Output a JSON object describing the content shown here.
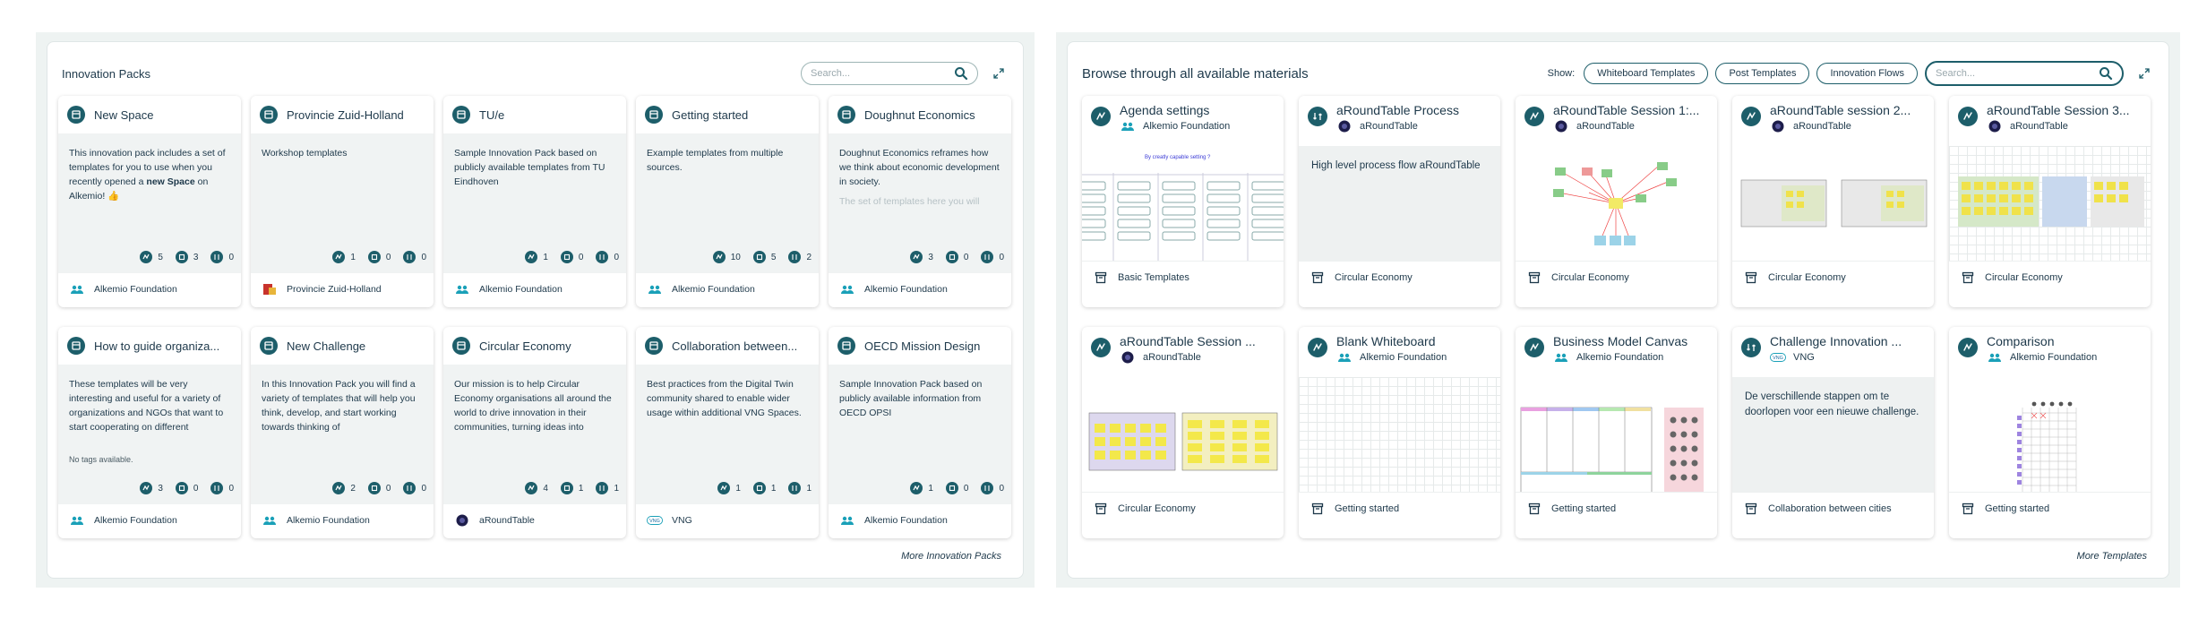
{
  "innovation_packs": {
    "title": "Innovation Packs",
    "search_placeholder": "Search...",
    "more_link": "More Innovation Packs",
    "cards": [
      {
        "title": "New Space",
        "desc_html": true,
        "desc_pre": "This innovation pack includes a set of templates for you to use when you recently opened a ",
        "desc_bold": "new Space",
        "desc_post": " on Alkemio! 👍",
        "tags": "",
        "c1": "5",
        "c2": "3",
        "c3": "0",
        "host": "Alkemio Foundation",
        "host_icon": "people-icon"
      },
      {
        "title": "Provincie Zuid-Holland",
        "desc": "Workshop templates",
        "tags": "",
        "c1": "1",
        "c2": "0",
        "c3": "0",
        "host": "Provincie Zuid-Holland",
        "host_icon": "province-logo-icon"
      },
      {
        "title": "TU/e",
        "desc": "Sample Innovation Pack based on publicly available templates from TU Eindhoven",
        "tags": "",
        "c1": "1",
        "c2": "0",
        "c3": "0",
        "host": "Alkemio Foundation",
        "host_icon": "people-icon"
      },
      {
        "title": "Getting started",
        "desc": "Example templates from multiple sources.",
        "tags": "",
        "c1": "10",
        "c2": "5",
        "c3": "2",
        "host": "Alkemio Foundation",
        "host_icon": "people-icon"
      },
      {
        "title": "Doughnut Economics",
        "desc": "Doughnut Economics reframes how we think about economic development in society.",
        "desc_fade": "The set of templates here you will",
        "tags": "",
        "c1": "3",
        "c2": "0",
        "c3": "0",
        "host": "Alkemio Foundation",
        "host_icon": "people-icon"
      },
      {
        "title": "How to guide organiza...",
        "desc": "These templates will be very interesting and useful for a variety of organizations and NGOs that want to start cooperating on different",
        "tags": "No tags available.",
        "c1": "3",
        "c2": "0",
        "c3": "0",
        "host": "Alkemio Foundation",
        "host_icon": "people-icon"
      },
      {
        "title": "New Challenge",
        "desc": "In this Innovation Pack you will find a variety of templates that will help you think, develop, and start working towards thinking of",
        "tags": "",
        "c1": "2",
        "c2": "0",
        "c3": "0",
        "host": "Alkemio Foundation",
        "host_icon": "people-icon"
      },
      {
        "title": "Circular Economy",
        "desc": "Our mission is to help Circular Economy organisations all around the world to drive innovation in their communities, turning ideas into",
        "tags": "",
        "c1": "4",
        "c2": "1",
        "c3": "1",
        "host": "aRoundTable",
        "host_icon": "roundtable-avatar-icon"
      },
      {
        "title": "Collaboration between...",
        "desc": "Best practices from the Digital Twin community shared to enable wider usage within additional VNG Spaces.",
        "tags": "",
        "c1": "1",
        "c2": "1",
        "c3": "1",
        "host": "VNG",
        "host_icon": "vng-logo-icon"
      },
      {
        "title": "OECD Mission Design",
        "desc": "Sample Innovation Pack based on publicly available information from OECD OPSI",
        "tags": "",
        "c1": "1",
        "c2": "0",
        "c3": "0",
        "host": "Alkemio Foundation",
        "host_icon": "people-icon"
      }
    ]
  },
  "templates": {
    "title": "Browse through all available materials",
    "show_label": "Show:",
    "filters": [
      "Whiteboard Templates",
      "Post Templates",
      "Innovation Flows"
    ],
    "search_placeholder": "Search...",
    "more_link": "More Templates",
    "cards": [
      {
        "title": "Agenda settings",
        "author": "Alkemio Foundation",
        "author_icon": "people-icon",
        "type": "whiteboard",
        "preview": "agenda-table",
        "preview_caption": "By creatly capable setting ?",
        "pack": "Basic Templates"
      },
      {
        "title": "aRoundTable Process",
        "author": "aRoundTable",
        "author_icon": "roundtable-avatar-icon",
        "type": "flow",
        "preview": "text",
        "preview_text": "High level process flow aRoundTable",
        "pack": "Circular Economy"
      },
      {
        "title": "aRoundTable Session 1:...",
        "author": "aRoundTable",
        "author_icon": "roundtable-avatar-icon",
        "type": "whiteboard",
        "preview": "mindmap",
        "pack": "Circular Economy"
      },
      {
        "title": "aRoundTable session 2...",
        "author": "aRoundTable",
        "author_icon": "roundtable-avatar-icon",
        "type": "whiteboard",
        "preview": "two-boards",
        "pack": "Circular Economy"
      },
      {
        "title": "aRoundTable Session 3...",
        "author": "aRoundTable",
        "author_icon": "roundtable-avatar-icon",
        "type": "whiteboard",
        "preview": "sticky-grid",
        "pack": "Circular Economy"
      },
      {
        "title": "aRoundTable Session ...",
        "author": "aRoundTable",
        "author_icon": "roundtable-avatar-icon",
        "type": "whiteboard",
        "preview": "yellow-boards",
        "pack": "Circular Economy"
      },
      {
        "title": "Blank Whiteboard",
        "author": "Alkemio Foundation",
        "author_icon": "people-icon",
        "type": "whiteboard",
        "preview": "blank",
        "pack": "Getting started"
      },
      {
        "title": "Business Model Canvas",
        "author": "Alkemio Foundation",
        "author_icon": "people-icon",
        "type": "whiteboard",
        "preview": "bmc",
        "pack": "Getting started"
      },
      {
        "title": "Challenge Innovation ...",
        "author": "VNG",
        "author_icon": "vng-logo-icon",
        "type": "flow",
        "preview": "text",
        "preview_text": "De verschillende stappen om te doorlopen voor een nieuwe challenge.",
        "pack": "Collaboration between cities"
      },
      {
        "title": "Comparison",
        "author": "Alkemio Foundation",
        "author_icon": "people-icon",
        "type": "whiteboard",
        "preview": "comparison",
        "pack": "Getting started"
      }
    ]
  }
}
